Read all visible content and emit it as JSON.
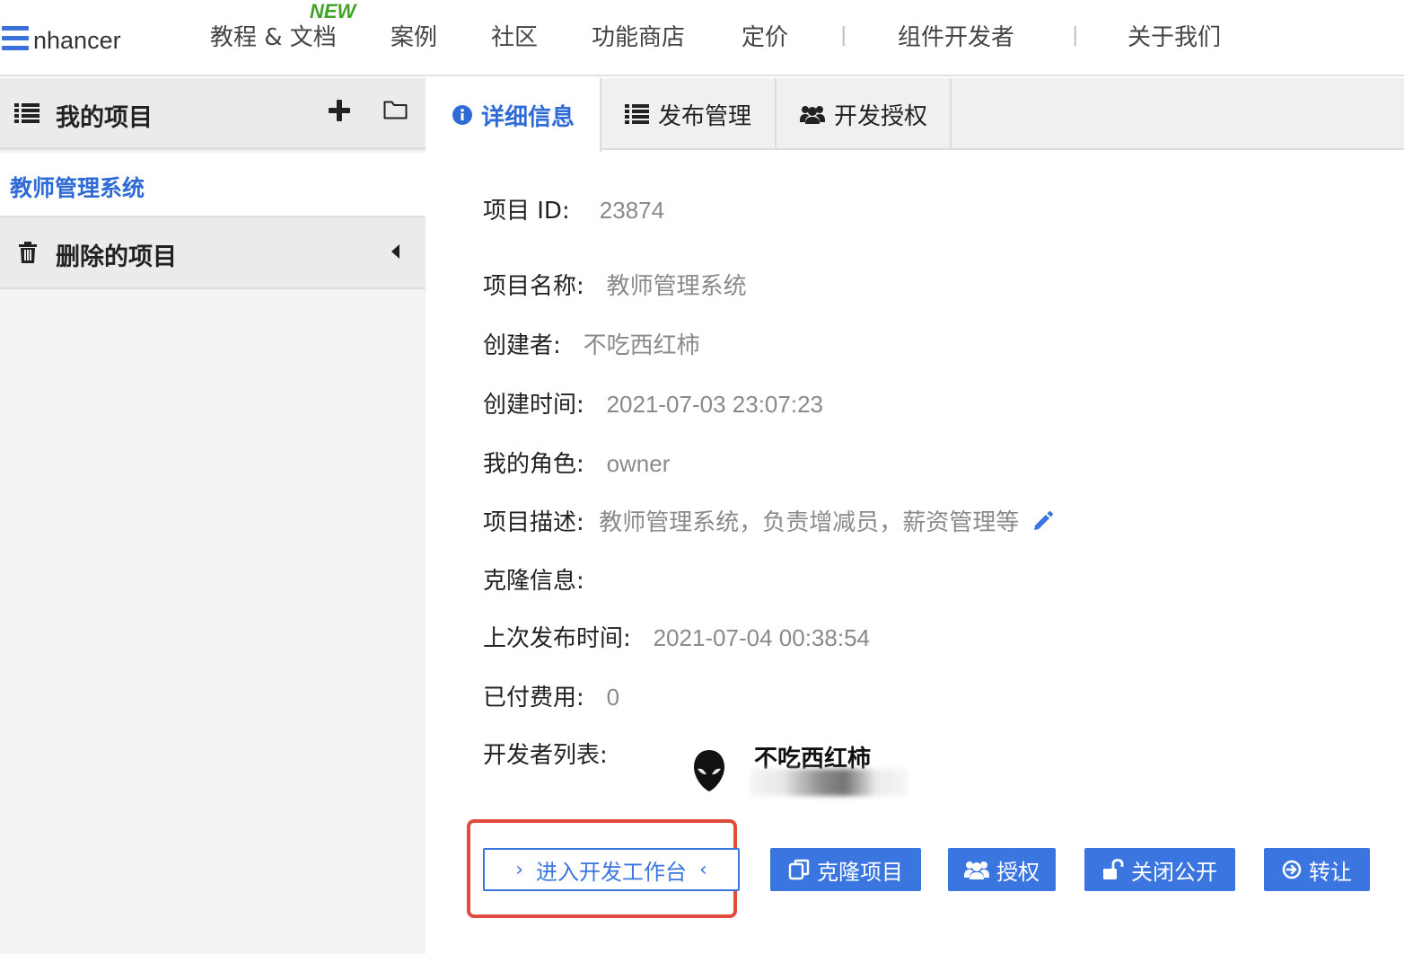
{
  "logo": {
    "text": "nhancer"
  },
  "nav": {
    "new_badge": "NEW",
    "items": [
      "教程 & 文档",
      "案例",
      "社区",
      "功能商店",
      "定价",
      "组件开发者",
      "关于我们"
    ],
    "separator": "|"
  },
  "sidebar": {
    "title": "我的项目",
    "active_project": "教师管理系统",
    "deleted_label": "删除的项目"
  },
  "tabs": [
    "详细信息",
    "发布管理",
    "开发授权"
  ],
  "details": {
    "id_label": "项目 ID:",
    "id_value": "23874",
    "name_label": "项目名称:",
    "name_value": "教师管理系统",
    "creator_label": "创建者:",
    "creator_value": "不吃西红柿",
    "created_label": "创建时间:",
    "created_value": "2021-07-03 23:07:23",
    "role_label": "我的角色:",
    "role_value": "owner",
    "desc_label": "项目描述:",
    "desc_value": "教师管理系统，负责增减员，薪资管理等",
    "clone_label": "克隆信息:",
    "clone_value": "",
    "published_label": "上次发布时间:",
    "published_value": "2021-07-04 00:38:54",
    "paid_label": "已付费用:",
    "paid_value": "0",
    "devs_label": "开发者列表:",
    "dev_name": "不吃西红柿"
  },
  "buttons": {
    "enter_workspace": "进入开发工作台",
    "clone": "克隆项目",
    "authorize": "授权",
    "close_public": "关闭公开",
    "transfer": "转让"
  },
  "colors": {
    "accent": "#3b76e0",
    "highlight": "#e04b3c",
    "new_badge": "#41a428"
  }
}
